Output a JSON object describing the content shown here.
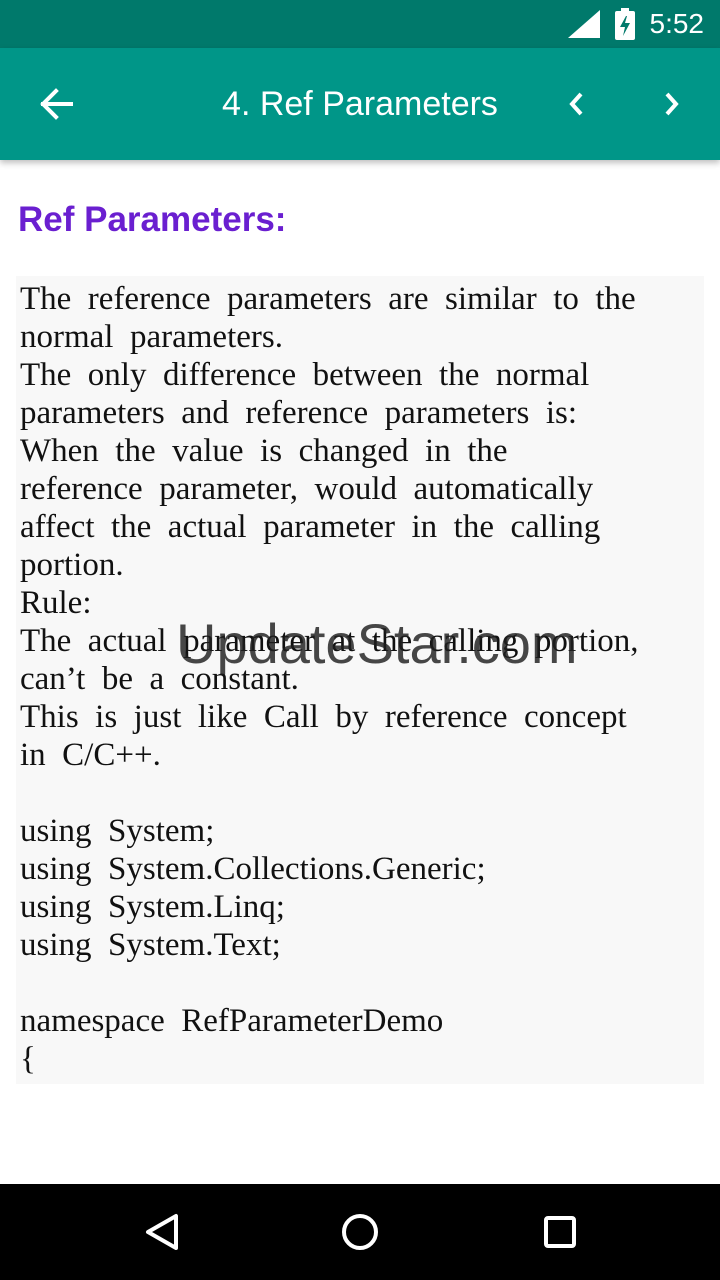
{
  "status_bar": {
    "time": "5:52",
    "icons": [
      "signal-icon",
      "battery-charging-icon"
    ]
  },
  "app_bar": {
    "title": "4. Ref Parameters",
    "icons": [
      "arrow-left-icon",
      "chevron-left-icon",
      "chevron-right-icon"
    ]
  },
  "content": {
    "heading": "Ref Parameters:",
    "heading_color": "#6a1fd0",
    "lines": [
      "The  reference  parameters  are  similar  to  the",
      "normal  parameters.",
      "The  only  difference  between  the  normal",
      "parameters  and  reference  parameters  is:",
      "When  the  value  is  changed  in  the",
      "reference  parameter,  would  automatically",
      "affect  the  actual  parameter  in  the  calling",
      "portion.",
      "Rule:",
      "The  actual  parameter  at  the  calling  portion,",
      "can’t  be  a  constant.",
      "This  is  just  like  Call  by  reference  concept",
      "in  C/C++.",
      "",
      "using  System;",
      "using  System.Collections.Generic;",
      "using  System.Linq;",
      "using  System.Text;",
      "",
      "namespace  RefParameterDemo",
      "{"
    ],
    "watermark": "UpdateStar.com"
  },
  "nav_bar": {
    "icons": [
      "nav-back-icon",
      "nav-home-icon",
      "nav-recents-icon"
    ]
  },
  "colors": {
    "status_bar": "#00796b",
    "app_bar": "#009688",
    "nav_bar": "#000000",
    "body_box": "#f8f8f8"
  }
}
